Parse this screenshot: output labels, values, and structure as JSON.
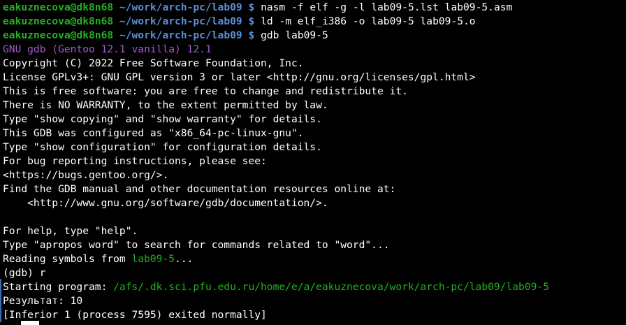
{
  "colors": {
    "background": "#000000",
    "foreground": "#ffffff",
    "prompt_user": "#22b11f",
    "prompt_path": "#5b8ed8",
    "gdb_banner": "#a05bd0",
    "path_highlight": "#22b11f"
  },
  "prompts": [
    {
      "user": "eakuznecova@dk8n68",
      "path": "~/work/arch-pc/lab09",
      "symbol": "$",
      "command": "nasm -f elf -g -l lab09-5.lst lab09-5.asm"
    },
    {
      "user": "eakuznecova@dk8n68",
      "path": "~/work/arch-pc/lab09",
      "symbol": "$",
      "command": "ld -m elf_i386 -o lab09-5 lab09-5.o"
    },
    {
      "user": "eakuznecova@dk8n68",
      "path": "~/work/arch-pc/lab09",
      "symbol": "$",
      "command": "gdb lab09-5"
    }
  ],
  "gdb_banner": "GNU gdb (Gentoo 12.1 vanilla) 12.1",
  "output_lines": [
    "Copyright (C) 2022 Free Software Foundation, Inc.",
    "License GPLv3+: GNU GPL version 3 or later <http://gnu.org/licenses/gpl.html>",
    "This is free software: you are free to change and redistribute it.",
    "There is NO WARRANTY, to the extent permitted by law.",
    "Type \"show copying\" and \"show warranty\" for details.",
    "This GDB was configured as \"x86_64-pc-linux-gnu\".",
    "Type \"show configuration\" for configuration details.",
    "For bug reporting instructions, please see:",
    "<https://bugs.gentoo.org/>.",
    "Find the GDB manual and other documentation resources online at:",
    "    <http://www.gnu.org/software/gdb/documentation/>.",
    "",
    "For help, type \"help\".",
    "Type \"apropos word\" to search for commands related to \"word\"..."
  ],
  "reading_symbols": {
    "prefix": "Reading symbols from ",
    "file": "lab09-5",
    "suffix": "..."
  },
  "gdb_command": "(gdb) r",
  "starting_program": {
    "prefix": "Starting program: ",
    "path": "/afs/.dk.sci.pfu.edu.ru/home/e/a/eakuznecova/work/arch-pc/lab09/lab09-5"
  },
  "result_line": "Результат: 10",
  "inferior_line": "[Inferior 1 (process 7595) exited normally]"
}
